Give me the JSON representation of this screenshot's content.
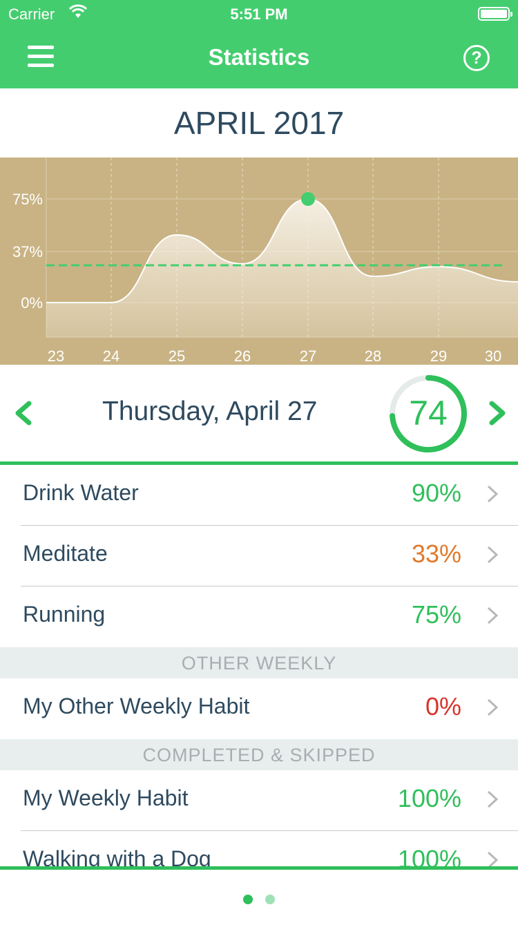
{
  "status_bar": {
    "carrier": "Carrier",
    "time": "5:51 PM"
  },
  "nav": {
    "title": "Statistics",
    "menu_icon": "hamburger-menu-icon",
    "help_icon": "question-circle-icon",
    "help_glyph": "?"
  },
  "month_title": "APRIL 2017",
  "chart_data": {
    "type": "area",
    "x": [
      "23",
      "24",
      "25",
      "26",
      "27",
      "28",
      "29",
      "30"
    ],
    "values": [
      0,
      0,
      49,
      28,
      75,
      19,
      26,
      15
    ],
    "average": 27,
    "highlight_index": 4,
    "yticks": [
      "0%",
      "37%",
      "75%"
    ],
    "ytick_values": [
      0,
      37,
      75
    ],
    "ylim": [
      -25,
      105
    ],
    "grid": true,
    "colors": {
      "background": "#c9b384",
      "line": "#ffffff",
      "average_line": "#44cd6f",
      "highlight": "#44cd6f"
    }
  },
  "day": {
    "label": "Thursday, April 27",
    "score": "74",
    "score_fraction": 0.74,
    "prev_icon": "chevron-left-icon",
    "next_icon": "chevron-right-icon"
  },
  "habits": [
    {
      "name": "Drink Water",
      "percent": "90%",
      "color": "#2fbf5b"
    },
    {
      "name": "Meditate",
      "percent": "33%",
      "color": "#e07a2c"
    },
    {
      "name": "Running",
      "percent": "75%",
      "color": "#2fbf5b"
    }
  ],
  "other_weekly": {
    "header": "OTHER WEEKLY",
    "items": [
      {
        "name": "My Other Weekly Habit",
        "percent": "0%",
        "color": "#d9342c"
      }
    ]
  },
  "completed": {
    "header": "COMPLETED & SKIPPED",
    "items": [
      {
        "name": "My Weekly Habit",
        "percent": "100%",
        "color": "#2fbf5b"
      },
      {
        "name": "Walking with a Dog",
        "percent": "100%",
        "color": "#2fbf5b"
      }
    ]
  },
  "page_indicator": {
    "count": 2,
    "active": 0,
    "colors": {
      "active": "#2fbf5b",
      "inactive": "#9fe0b4"
    }
  }
}
